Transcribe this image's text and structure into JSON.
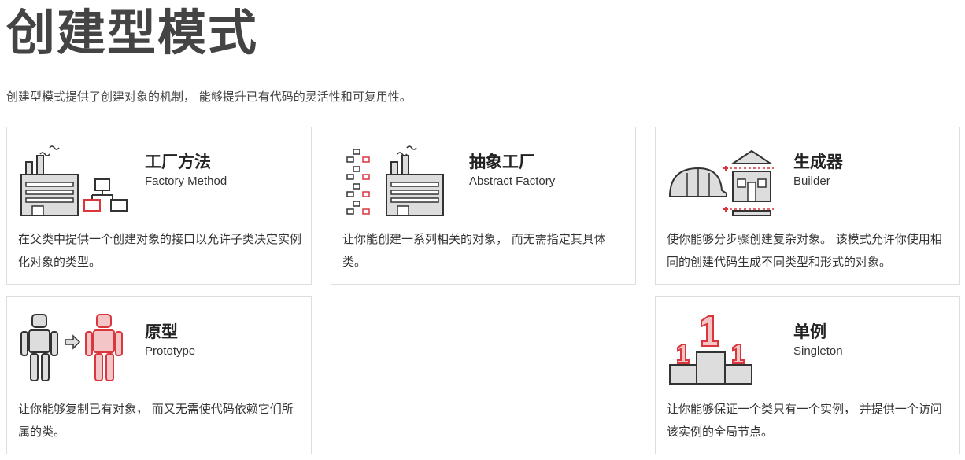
{
  "header": {
    "title": "创建型模式",
    "intro": "创建型模式提供了创建对象的机制， 能够提升已有代码的灵活性和可复用性。"
  },
  "patterns": [
    {
      "title": "工厂方法",
      "subtitle": "Factory Method",
      "description": "在父类中提供一个创建对象的接口以允许子类决定实例化对象的类型。",
      "icon": "factory-icon"
    },
    {
      "title": "抽象工厂",
      "subtitle": "Abstract Factory",
      "description": "让你能创建一系列相关的对象， 而无需指定其具体类。",
      "icon": "abstract-factory-icon"
    },
    {
      "title": "生成器",
      "subtitle": "Builder",
      "description": "使你能够分步骤创建复杂对象。 该模式允许你使用相同的创建代码生成不同类型和形式的对象。",
      "icon": "builder-icon"
    },
    {
      "title": "原型",
      "subtitle": "Prototype",
      "description": "让你能够复制已有对象， 而又无需使代码依赖它们所属的类。",
      "icon": "robot-clone-icon"
    },
    {
      "title": "单例",
      "subtitle": "Singleton",
      "description": "让你能够保证一个类只有一个实例， 并提供一个访问该实例的全局节点。",
      "icon": "podium-icon"
    }
  ],
  "colors": {
    "accent": "#d9363e",
    "outline": "#333333",
    "fill_gray": "#dddddd"
  }
}
